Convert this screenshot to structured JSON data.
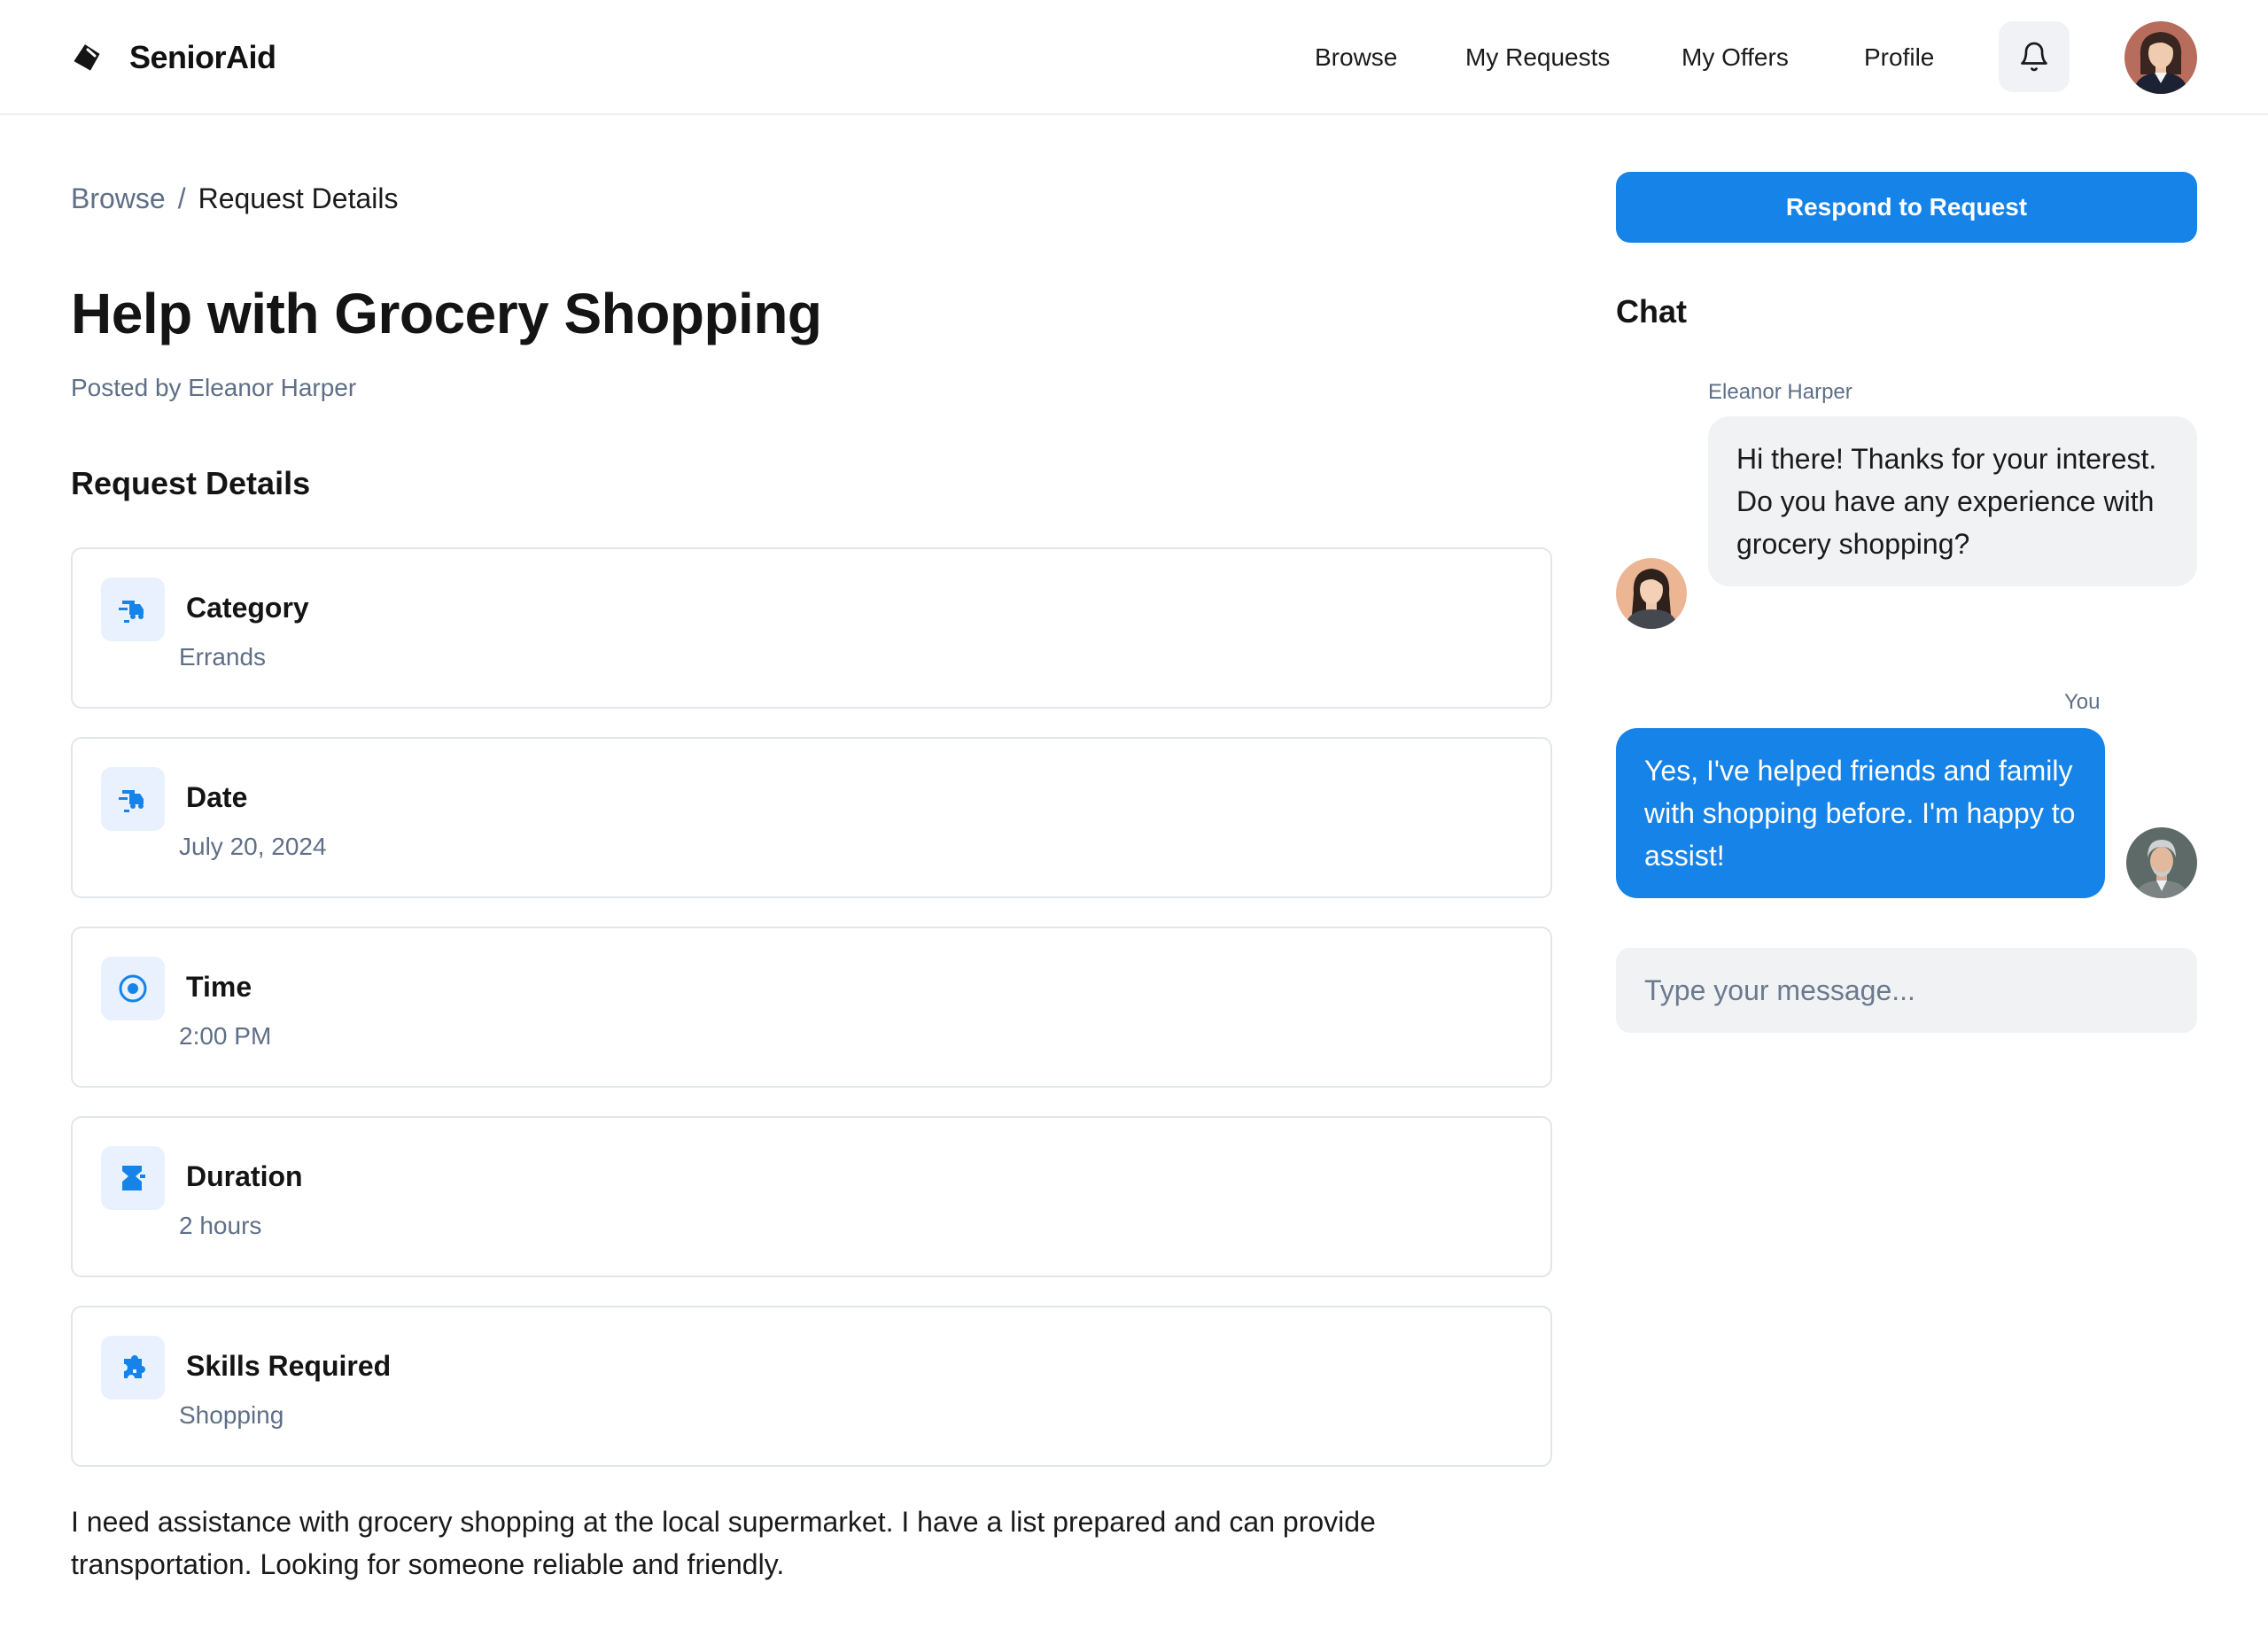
{
  "header": {
    "brand": "SeniorAid",
    "nav": [
      {
        "label": "Browse"
      },
      {
        "label": "My Requests"
      },
      {
        "label": "My Offers"
      },
      {
        "label": "Profile"
      }
    ]
  },
  "breadcrumb": {
    "parent": "Browse",
    "separator": "/",
    "current": "Request Details"
  },
  "request": {
    "title": "Help with Grocery Shopping",
    "posted_by": "Posted by Eleanor Harper",
    "section_title": "Request Details",
    "details": [
      {
        "label": "Category",
        "value": "Errands",
        "icon": "delivery-icon"
      },
      {
        "label": "Date",
        "value": "July 20, 2024",
        "icon": "delivery-icon"
      },
      {
        "label": "Time",
        "value": "2:00 PM",
        "icon": "clock-icon"
      },
      {
        "label": "Duration",
        "value": "2 hours",
        "icon": "hourglass-icon"
      },
      {
        "label": "Skills Required",
        "value": "Shopping",
        "icon": "puzzle-icon"
      }
    ],
    "description": "I need assistance with grocery shopping at the local supermarket. I have a list prepared and can provide transportation. Looking for someone reliable and friendly."
  },
  "sidebar": {
    "respond_button": "Respond to Request",
    "chat_title": "Chat",
    "messages": [
      {
        "sender": "Eleanor Harper",
        "text": "Hi there! Thanks for your interest. Do you have any experience with grocery shopping?"
      },
      {
        "sender": "You",
        "text": "Yes, I've helped friends and family with shopping before. I'm happy to assist!"
      }
    ],
    "input_placeholder": "Type your message..."
  },
  "colors": {
    "accent": "#1683e8",
    "icon_bg": "#e8f1fd",
    "muted_text": "#5e6f87",
    "bubble_in": "#f1f2f4"
  }
}
